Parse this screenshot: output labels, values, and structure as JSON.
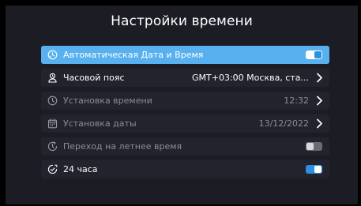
{
  "header": {
    "title": "Настройки времени"
  },
  "settings": [
    {
      "label": "Автоматическая Дата и Время",
      "value": "",
      "control": "toggle",
      "state": "on",
      "icon": "auto-clock-icon"
    },
    {
      "label": "Часовой пояс",
      "value": "GMT+03:00 Москва, ста...",
      "control": "chevron",
      "icon": "timezone-icon"
    },
    {
      "label": "Установка времени",
      "value": "12:32",
      "control": "chevron",
      "icon": "clock-icon"
    },
    {
      "label": "Установка даты",
      "value": "13/12/2022",
      "control": "chevron",
      "icon": "calendar-icon"
    },
    {
      "label": "Переход на летнее время",
      "value": "",
      "control": "toggle",
      "state": "off",
      "icon": "daylight-clock-icon"
    },
    {
      "label": "24 часа",
      "value": "",
      "control": "toggle",
      "state": "on",
      "icon": "clock-24-icon"
    }
  ],
  "colors": {
    "background": "#1c1c24",
    "row": "#23232d",
    "active_row": "#58b1ee",
    "toggle_on": "#2e8fe0",
    "toggle_off": "#6b6b73",
    "disabled_text": "#8c8c96"
  }
}
